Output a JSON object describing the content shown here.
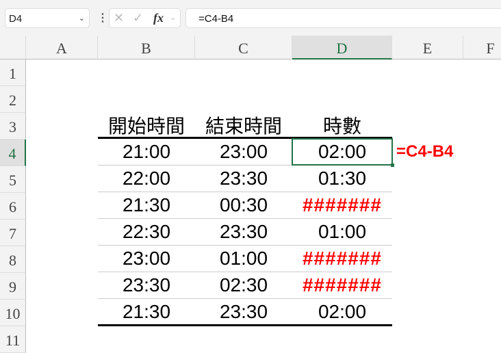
{
  "name_box": "D4",
  "formula": "=C4-B4",
  "fx_label": "fx",
  "columns": [
    "A",
    "B",
    "C",
    "D",
    "E",
    "F"
  ],
  "rows": [
    "1",
    "2",
    "3",
    "4",
    "5",
    "6",
    "7",
    "8",
    "9",
    "10",
    "11"
  ],
  "headers": [
    "開始時間",
    "結束時間",
    "時數"
  ],
  "table": [
    [
      "21:00",
      "23:00",
      "02:00"
    ],
    [
      "22:00",
      "23:30",
      "01:30"
    ],
    [
      "21:30",
      "00:30",
      "#######"
    ],
    [
      "22:30",
      "23:30",
      "01:00"
    ],
    [
      "23:00",
      "01:00",
      "#######"
    ],
    [
      "23:30",
      "02:30",
      "#######"
    ],
    [
      "21:30",
      "23:30",
      "02:00"
    ]
  ],
  "annotation": "=C4-B4",
  "colors": {
    "accent": "#217346",
    "error": "#ff0000"
  }
}
